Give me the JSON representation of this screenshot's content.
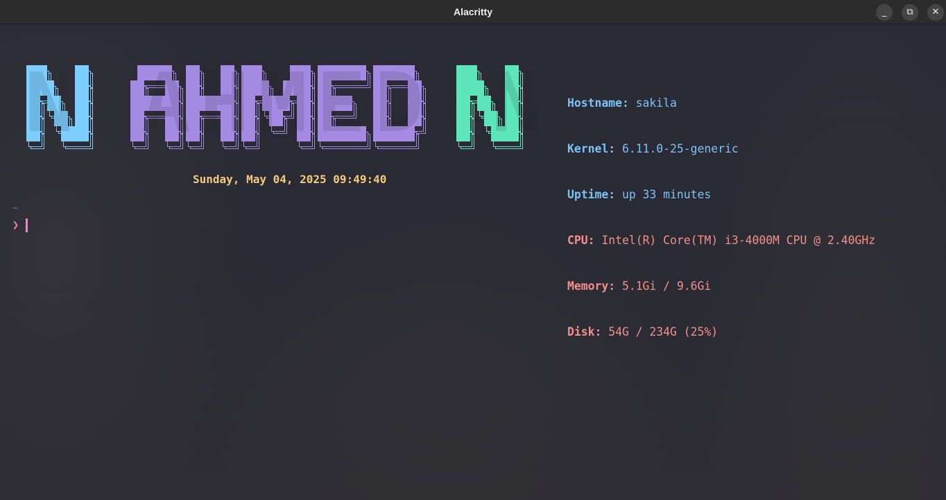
{
  "window": {
    "title": "Alacritty",
    "controls": [
      "minimize",
      "maximize",
      "close"
    ]
  },
  "banner": {
    "text": "N AHMED N",
    "colors": {
      "first": "#7dcdff",
      "middle": "#a48ae2",
      "last": "#5ee6bb"
    }
  },
  "info": {
    "hostname": {
      "label": "Hostname:",
      "value": "sakila"
    },
    "kernel": {
      "label": "Kernel:",
      "value": "6.11.0-25-generic"
    },
    "uptime": {
      "label": "Uptime:",
      "value": "up 33 minutes"
    },
    "cpu": {
      "label": "CPU:",
      "value": "Intel(R) Core(TM) i3-4000M CPU @ 2.40GHz"
    },
    "memory": {
      "label": "Memory:",
      "value": "5.1Gi / 9.6Gi"
    },
    "disk": {
      "label": "Disk:",
      "value": "54G / 234G (25%)"
    }
  },
  "datetime": "Sunday, May 04, 2025 09:49:40",
  "prompt": {
    "cwd": "~",
    "symbol": "❯"
  }
}
